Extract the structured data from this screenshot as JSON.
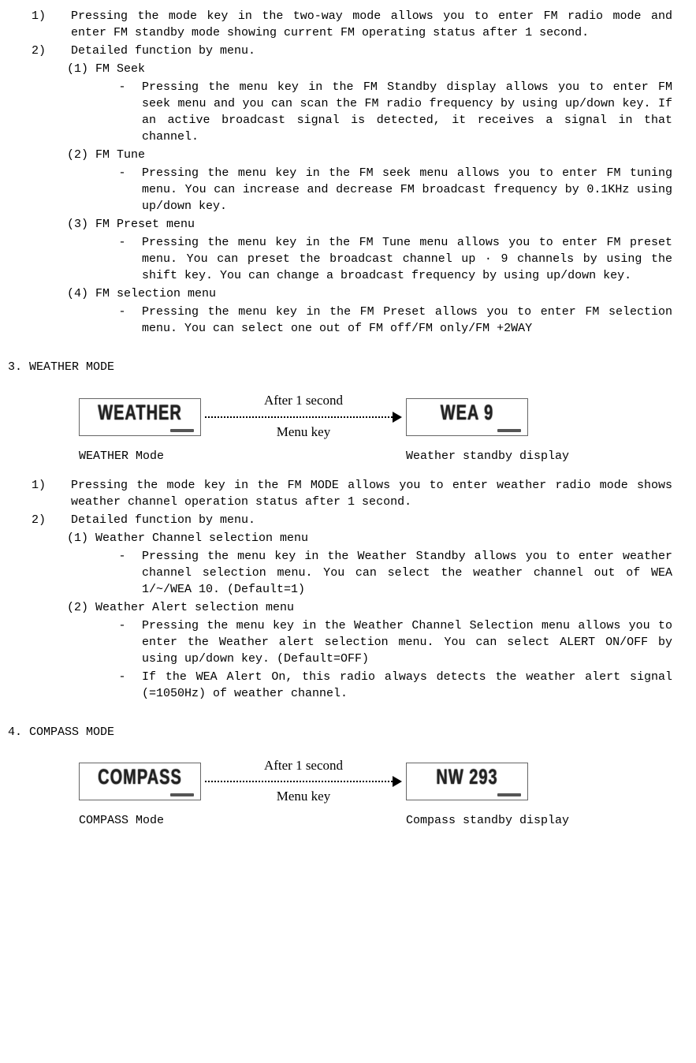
{
  "fm": {
    "items": {
      "i1": {
        "m": "1)",
        "t": "Pressing the mode key in the two-way mode allows you to enter FM radio mode and enter FM standby mode showing current FM operating status after 1 second."
      },
      "i2": {
        "m": "2)",
        "t": "Detailed function by menu."
      },
      "s1": {
        "t": "(1) FM Seek"
      },
      "s1d": {
        "m": "-",
        "t": "Pressing the menu key in the FM Standby display allows you to enter FM seek menu and you can scan the FM radio frequency by using up/down key. If an active broadcast signal is detected, it receives a signal in that channel."
      },
      "s2": {
        "t": "(2) FM Tune"
      },
      "s2d": {
        "m": "-",
        "t": "Pressing the menu key in the FM seek menu allows you to enter FM tuning menu. You can increase and decrease FM broadcast frequency by 0.1KHz using up/down key."
      },
      "s3": {
        "t": "(3) FM Preset menu"
      },
      "s3d": {
        "m": "-",
        "t": "Pressing the menu key in the FM Tune menu allows you to enter FM preset menu. You can preset the broadcast channel up · 9 channels by using the shift key. You can change a broadcast frequency by using up/down key."
      },
      "s4": {
        "t": "(4) FM selection menu"
      },
      "s4d": {
        "m": "-",
        "t": "Pressing the menu key in the FM Preset allows you to enter FM selection menu. You can select one out of FM off/FM only/FM +2WAY"
      }
    }
  },
  "weather": {
    "title": "3. WEATHER MODE",
    "diagram": {
      "lcd1": "WEATHER",
      "lcd2": "WEA      9",
      "arrow_top": "After 1 second",
      "arrow_bottom": "Menu key",
      "cap1": "WEATHER Mode",
      "cap2": "Weather standby display"
    },
    "items": {
      "i1": {
        "m": "1)",
        "t": "Pressing the mode key in the FM MODE allows you to enter weather radio mode shows weather channel operation status after 1 second."
      },
      "i2": {
        "m": "2)",
        "t": "Detailed function by menu."
      },
      "s1": {
        "t": "(1)  Weather Channel selection menu"
      },
      "s1d": {
        "m": "-",
        "t": "Pressing the menu key in the Weather Standby allows you to enter weather channel selection menu. You can select the weather channel out of WEA 1/~/WEA 10. (Default=1)"
      },
      "s2": {
        "t": "(2)  Weather Alert selection menu"
      },
      "s2d": {
        "m": "-",
        "t": "Pressing the menu key in the Weather Channel Selection menu allows you to enter the Weather alert selection menu. You can select ALERT ON/OFF by using up/down key. (Default=OFF)"
      },
      "s2d2": {
        "m": "-",
        "t": "If the WEA Alert On, this radio always detects the weather alert signal (=1050Hz) of weather channel."
      }
    }
  },
  "compass": {
    "title": "4. COMPASS MODE",
    "diagram": {
      "lcd1": "COMPASS",
      "lcd2": "NW 293",
      "arrow_top": "After 1 second",
      "arrow_bottom": "Menu key",
      "cap1": "COMPASS Mode",
      "cap2": "Compass standby display"
    }
  }
}
